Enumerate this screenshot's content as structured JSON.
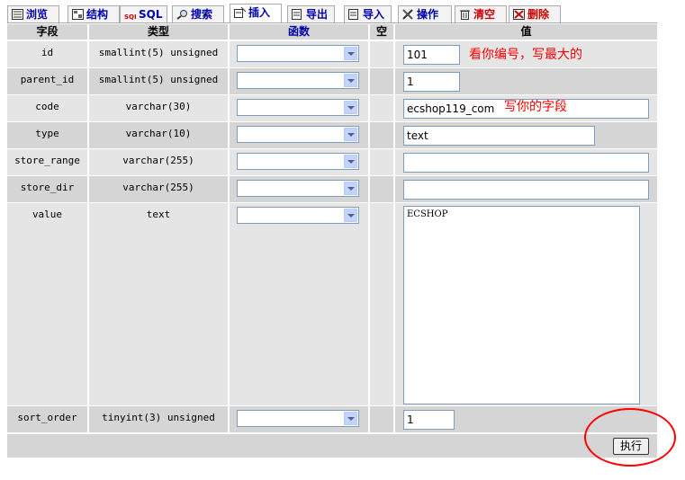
{
  "tabs": [
    {
      "label": "浏览",
      "icon": "browse-icon"
    },
    {
      "label": "结构",
      "icon": "structure-icon"
    },
    {
      "label": "SQL",
      "icon": "sql-icon"
    },
    {
      "label": "搜索",
      "icon": "search-icon"
    },
    {
      "label": "插入",
      "icon": "insert-icon",
      "active": true
    },
    {
      "label": "导出",
      "icon": "export-icon"
    },
    {
      "label": "导入",
      "icon": "import-icon"
    },
    {
      "label": "操作",
      "icon": "operations-icon"
    },
    {
      "label": "清空",
      "icon": "empty-icon"
    },
    {
      "label": "删除",
      "icon": "drop-icon"
    }
  ],
  "headers": {
    "field": "字段",
    "type": "类型",
    "function": "函数",
    "null": "空",
    "value": "值"
  },
  "rows": [
    {
      "field": "id",
      "type": "smallint(5) unsigned",
      "value": "101"
    },
    {
      "field": "parent_id",
      "type": "smallint(5) unsigned",
      "value": "1"
    },
    {
      "field": "code",
      "type": "varchar(30)",
      "value": "ecshop119_com"
    },
    {
      "field": "type",
      "type": "varchar(10)",
      "value": "text"
    },
    {
      "field": "store_range",
      "type": "varchar(255)",
      "value": ""
    },
    {
      "field": "store_dir",
      "type": "varchar(255)",
      "value": ""
    },
    {
      "field": "value",
      "type": "text",
      "value": "ECSHOP"
    },
    {
      "field": "sort_order",
      "type": "tinyint(3) unsigned",
      "value": "1"
    }
  ],
  "annotations": {
    "id_note": "看你编号，写最大的",
    "code_note": "写你的字段"
  },
  "submit_label": "执行",
  "colors": {
    "annotation": "#ff0000",
    "header_text": "#0000aa",
    "header_bg": "#d5d5d5"
  }
}
